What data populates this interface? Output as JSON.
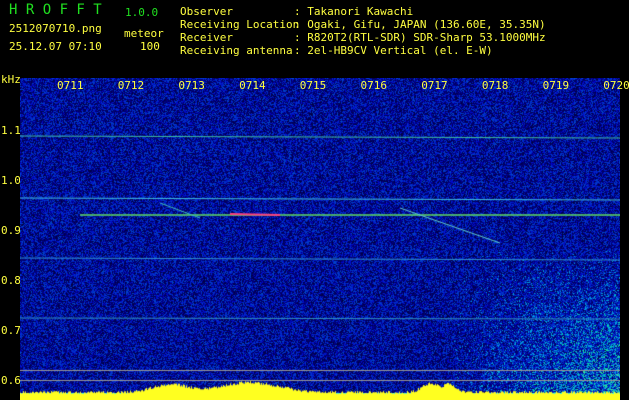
{
  "app": {
    "title": "H R O F F T",
    "version": "1.0.0"
  },
  "file": {
    "name": "2512070710.png",
    "datetime": "25.12.07 07:10",
    "mode": "meteor",
    "count": "100"
  },
  "info": [
    {
      "label": "Observer",
      "value": ": Takanori Kawachi"
    },
    {
      "label": "Receiving Location",
      "value": ": Ogaki, Gifu, JAPAN (136.60E, 35.35N)"
    },
    {
      "label": "Receiver",
      "value": ": R820T2(RTL-SDR) SDR-Sharp 53.1000MHz"
    },
    {
      "label": "Receiving antenna",
      "value": ": 2el-HB9CV Vertical (el. E-W)"
    }
  ],
  "axis": {
    "unit": "kHz",
    "y_ticks": [
      "1.1",
      "1.0",
      "0.9",
      "0.8",
      "0.7",
      "0.6"
    ],
    "x_ticks": [
      "0711",
      "0712",
      "0713",
      "0714",
      "0715",
      "0716",
      "0717",
      "0718",
      "0719",
      "0720"
    ]
  },
  "colors": {
    "label": "#ffff40",
    "title": "#20e020",
    "bg": "#000000"
  }
}
